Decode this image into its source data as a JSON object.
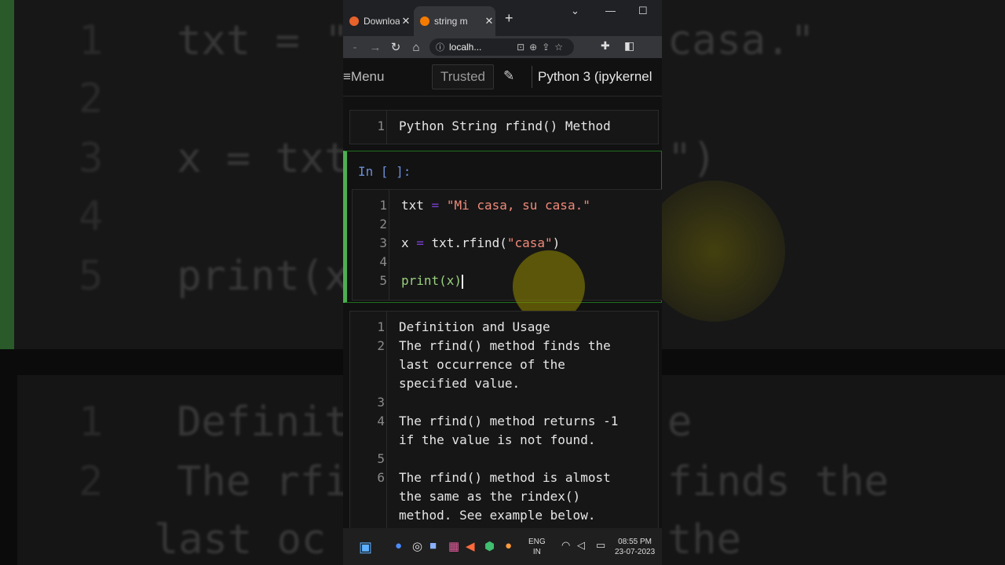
{
  "background": {
    "code_lines": [
      {
        "num": "1",
        "text": "txt = \"M",
        "tail": "casa.\""
      },
      {
        "num": "2",
        "text": "",
        "tail": ""
      },
      {
        "num": "3",
        "text": "x = txt",
        "tail": "\")"
      },
      {
        "num": "4",
        "text": "",
        "tail": ""
      },
      {
        "num": "5",
        "text": "print(x",
        "tail": ""
      }
    ],
    "md_lines": [
      {
        "num": "1",
        "text": "Definit",
        "tail": "e"
      },
      {
        "num": "2",
        "text": "The rfi",
        "tail": "finds the"
      },
      {
        "num": "",
        "text": "last oc",
        "tail": "the"
      }
    ]
  },
  "browser": {
    "tabs": [
      {
        "title": "Downloa",
        "favicon_color": "#e8622c"
      },
      {
        "title": "string m",
        "favicon_color": "#f57c00"
      }
    ],
    "address": "localh..."
  },
  "toolbar": {
    "menu_label": "Menu",
    "trusted_label": "Trusted",
    "kernel_label": "Python 3 (ipykernel"
  },
  "cells": {
    "md1": {
      "line_number": "1",
      "text": "Python String rfind() Method"
    },
    "code": {
      "prompt": "In [ ]:",
      "lines": [
        {
          "n": "1",
          "a": "txt ",
          "op": "=",
          "b": " ",
          "str": "\"Mi casa, su casa.\"",
          "c": ""
        },
        {
          "n": "2"
        },
        {
          "n": "3",
          "a": "x ",
          "op": "=",
          "b": " txt.rfind(",
          "str": "\"casa\"",
          "c": ")"
        },
        {
          "n": "4"
        },
        {
          "n": "5",
          "fn": "print(x)"
        }
      ]
    },
    "md2": {
      "lines": [
        {
          "n": "1",
          "t": "Definition and Usage"
        },
        {
          "n": "2",
          "t": "The rfind() method finds the"
        },
        {
          "n": "",
          "t": "last occurrence of the"
        },
        {
          "n": "",
          "t": "specified value."
        },
        {
          "n": "3",
          "t": ""
        },
        {
          "n": "4",
          "t": "The rfind() method returns -1"
        },
        {
          "n": "",
          "t": "if the value is not found."
        },
        {
          "n": "5",
          "t": ""
        },
        {
          "n": "6",
          "t": "The rfind() method is almost"
        },
        {
          "n": "",
          "t": "the same as the rindex()"
        },
        {
          "n": "",
          "t": "method. See example below."
        }
      ]
    }
  },
  "taskbar": {
    "lang_top": "ENG",
    "lang_bottom": "IN",
    "time": "08:55 PM",
    "date": "23-07-2023"
  },
  "colors": {
    "accent_green": "#4caf50",
    "string": "#f08a7a",
    "operator": "#7a3fd1",
    "builtin": "#9ad07f"
  }
}
